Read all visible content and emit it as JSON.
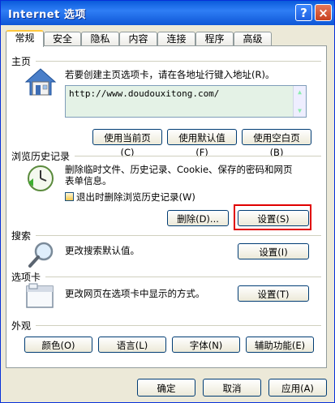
{
  "window": {
    "title": "Internet 选项",
    "help_label": "?",
    "close_label": "×"
  },
  "tabs": [
    "常规",
    "安全",
    "隐私",
    "内容",
    "连接",
    "程序",
    "高级"
  ],
  "homepage": {
    "section_label": "主页",
    "description": "若要创建主页选项卡，请在各地址行键入地址(R)。",
    "url": "http://www.doudouxitong.com/",
    "btn_current": "使用当前页(C)",
    "btn_default": "使用默认值(F)",
    "btn_blank": "使用空白页(B)"
  },
  "history": {
    "section_label": "浏览历史记录",
    "description_line1": "删除临时文件、历史记录、Cookie、保存的密码和网页",
    "description_line2": "表单信息。",
    "checkbox_label": "退出时删除浏览历史记录(W)",
    "btn_delete": "删除(D)...",
    "btn_settings": "设置(S)"
  },
  "search": {
    "section_label": "搜索",
    "description": "更改搜索默认值。",
    "btn_settings": "设置(I)"
  },
  "tabs_section": {
    "section_label": "选项卡",
    "description": "更改网页在选项卡中显示的方式。",
    "btn_settings": "设置(T)"
  },
  "appearance": {
    "section_label": "外观",
    "btn_colors": "颜色(O)",
    "btn_languages": "语言(L)",
    "btn_fonts": "字体(N)",
    "btn_accessibility": "辅助功能(E)"
  },
  "footer": {
    "btn_ok": "确定",
    "btn_cancel": "取消",
    "btn_apply": "应用(A)"
  }
}
